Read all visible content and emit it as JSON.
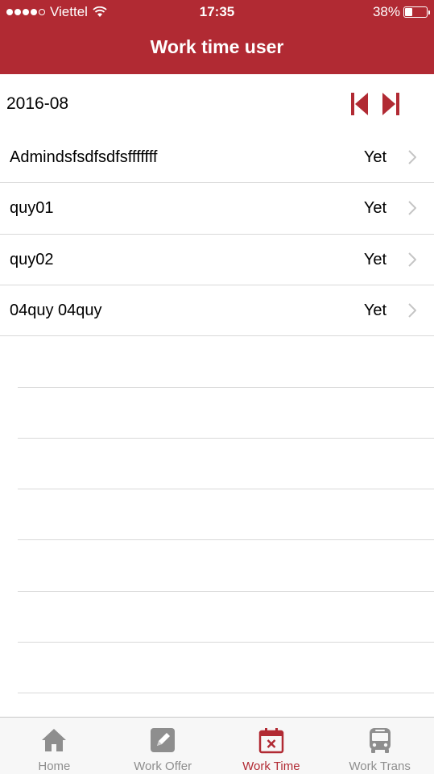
{
  "status_bar": {
    "carrier": "Viettel",
    "time": "17:35",
    "battery": "38%"
  },
  "header": {
    "title": "Work time user"
  },
  "month": {
    "value": "2016-08"
  },
  "users": [
    {
      "name": "Admindsfsdfsdfsfffffff",
      "status": "Yet"
    },
    {
      "name": "quy01",
      "status": "Yet"
    },
    {
      "name": "quy02",
      "status": "Yet"
    },
    {
      "name": "04quy 04quy",
      "status": "Yet"
    }
  ],
  "tabs": [
    {
      "label": "Home",
      "icon": "home-icon"
    },
    {
      "label": "Work Offer",
      "icon": "edit-icon"
    },
    {
      "label": "Work Time",
      "icon": "calendar-icon"
    },
    {
      "label": "Work Trans",
      "icon": "bus-icon"
    }
  ],
  "active_tab": "Work Time",
  "colors": {
    "brand": "#b12a33",
    "inactive": "#8e8e8e",
    "divider": "#d8d8d8"
  }
}
